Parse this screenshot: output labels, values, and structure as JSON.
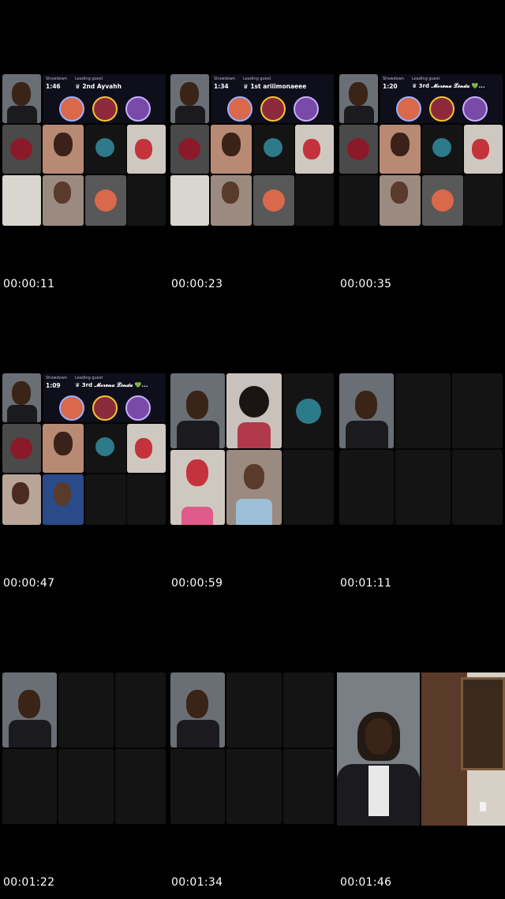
{
  "frames": [
    {
      "timestamp": "00:00:11",
      "showdown_label": "Showdown",
      "timer": "1:46",
      "leading_label": "Leading guest",
      "leading_guest": "♛ 2nd Ayvahh"
    },
    {
      "timestamp": "00:00:23",
      "showdown_label": "Showdown",
      "timer": "1:34",
      "leading_label": "Leading guest",
      "leading_guest": "♛ 1st ariiimonaeee"
    },
    {
      "timestamp": "00:00:35",
      "showdown_label": "Showdown",
      "timer": "1:20",
      "leading_label": "Leading guest",
      "leading_guest": "♛ 3rd 𝓜𝓸𝓻𝓮𝓷𝓪 𝓛𝓲𝓷𝓭𝓪 💚..."
    },
    {
      "timestamp": "00:00:47",
      "showdown_label": "Showdown",
      "timer": "1:09",
      "leading_label": "Leading guest",
      "leading_guest": "♛ 3rd 𝓜𝓸𝓻𝓮𝓷𝓪 𝓛𝓲𝓷𝓭𝓪 💚..."
    },
    {
      "timestamp": "00:00:59"
    },
    {
      "timestamp": "00:01:11"
    },
    {
      "timestamp": "00:01:22"
    },
    {
      "timestamp": "00:01:34"
    },
    {
      "timestamp": "00:01:46"
    }
  ],
  "colors": {
    "background": "#000000",
    "header": "#0f0f1b",
    "crown": "#f4c430",
    "empty_tile": "#141414"
  }
}
